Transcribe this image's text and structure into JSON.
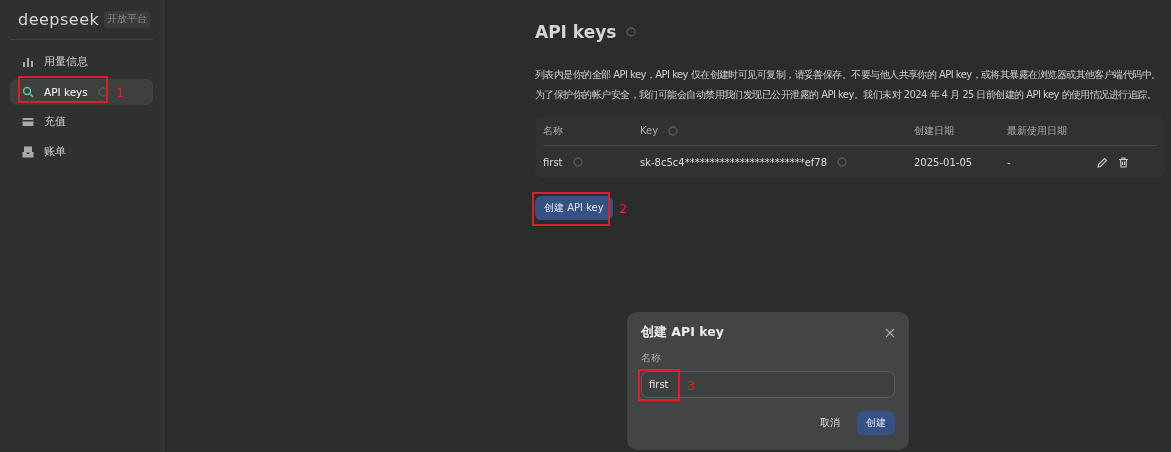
{
  "brand": {
    "logo": "deepseek",
    "badge": "开放平台"
  },
  "sidebar": {
    "items": [
      {
        "kind": "usage",
        "label": "用量信息",
        "selected": false,
        "loading": false
      },
      {
        "kind": "keys",
        "label": "API keys",
        "selected": true,
        "loading": true,
        "annotation": "1"
      },
      {
        "kind": "topup",
        "label": "充值",
        "selected": false,
        "loading": false
      },
      {
        "kind": "bills",
        "label": "账单",
        "selected": false,
        "loading": false
      }
    ]
  },
  "page": {
    "title": "API keys",
    "description": [
      "列表内是你的全部 API key，API key 仅在创建时可见可复制，请妥善保存。不要与他人共享你的 API key，或将其暴露在浏览器或其他客户端代码中。",
      "为了保护你的帐户安全，我们可能会自动禁用我们发现已公开泄露的 API key。我们未对 2024 年 4 月 25 日前创建的 API key 的使用情况进行追踪。"
    ]
  },
  "table": {
    "columns": [
      "名称",
      "Key",
      "创建日期",
      "最新使用日期"
    ],
    "rows": [
      {
        "name": "first",
        "key": "sk-8c5c4************************ef78",
        "created": "2025-01-05",
        "last_used": "-"
      }
    ]
  },
  "create_button": {
    "label": "创建 API key",
    "annotation": "2"
  },
  "dialog": {
    "title": "创建 API key",
    "field_label": "名称",
    "value": "first",
    "annotation": "3",
    "buttons": [
      {
        "label": "取消",
        "primary": false
      },
      {
        "label": "创建",
        "primary": true
      }
    ]
  }
}
